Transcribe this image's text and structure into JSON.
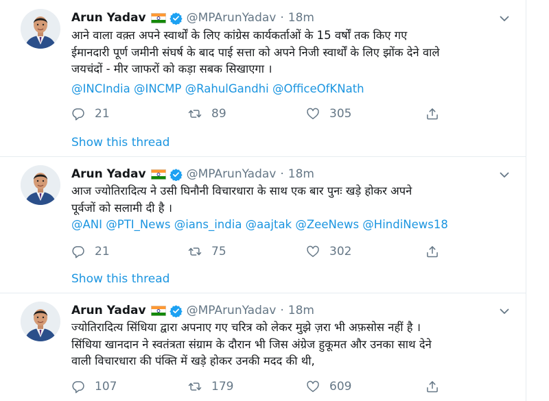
{
  "colors": {
    "link": "#1b95e0",
    "muted": "#657786",
    "text": "#14171a",
    "verified": "#1da1f2"
  },
  "icons": {
    "flag": "india-flag-emoji",
    "verified": "verified-badge-icon",
    "caret": "chevron-down-icon",
    "reply": "reply-icon",
    "retweet": "retweet-icon",
    "like": "heart-icon",
    "share": "share-icon"
  },
  "tweets": [
    {
      "name": "Arun Yadav",
      "handle": "@MPArunYadav",
      "dot": "·",
      "time": "18m",
      "lines": [
        "आने वाला वक़्त अपने स्वार्थों के लिए कांग्रेस कार्यकर्ताओं के 15 वर्षों तक किए गए",
        "ईमानदारी पूर्ण जमीनी संघर्ष के बाद पाई सत्ता को अपने निजी स्वार्थों के लिए झोंक देने वाले",
        "जयचंदों - मीर जाफरों को  कड़ा सबक सिखाएगा ।"
      ],
      "mentions": "@INCIndia @INCMP @RahulGandhi @OfficeOfKNath",
      "replies": "21",
      "retweets": "89",
      "likes": "305",
      "thread": "Show this thread"
    },
    {
      "name": "Arun Yadav",
      "handle": "@MPArunYadav",
      "dot": "·",
      "time": "18m",
      "lines": [
        "आज ज्योतिरादित्य ने उसी घिनौनी विचारधारा के साथ एक बार पुनः खड़े होकर अपने",
        "पूर्वजों को सलामी दी है ।"
      ],
      "mentions": "@ANI @PTI_News @ians_india @aajtak @ZeeNews @HindiNews18",
      "replies": "21",
      "retweets": "75",
      "likes": "302",
      "thread": "Show this thread"
    },
    {
      "name": "Arun Yadav",
      "handle": "@MPArunYadav",
      "dot": "·",
      "time": "18m",
      "lines": [
        "ज्योतिरादित्य सिंधिया द्वारा अपनाए गए चरित्र को लेकर मुझे ज़रा भी अफ़सोस नहीं है ।",
        "सिंधिया खानदान ने स्वतंत्रता संग्राम के दौरान भी जिस अंग्रेज हुकूमत और उनका साथ देने",
        "वाली विचारधारा की पंक्ति में खड़े होकर उनकी मदद की थी,"
      ],
      "replies": "107",
      "retweets": "179",
      "likes": "609"
    }
  ]
}
